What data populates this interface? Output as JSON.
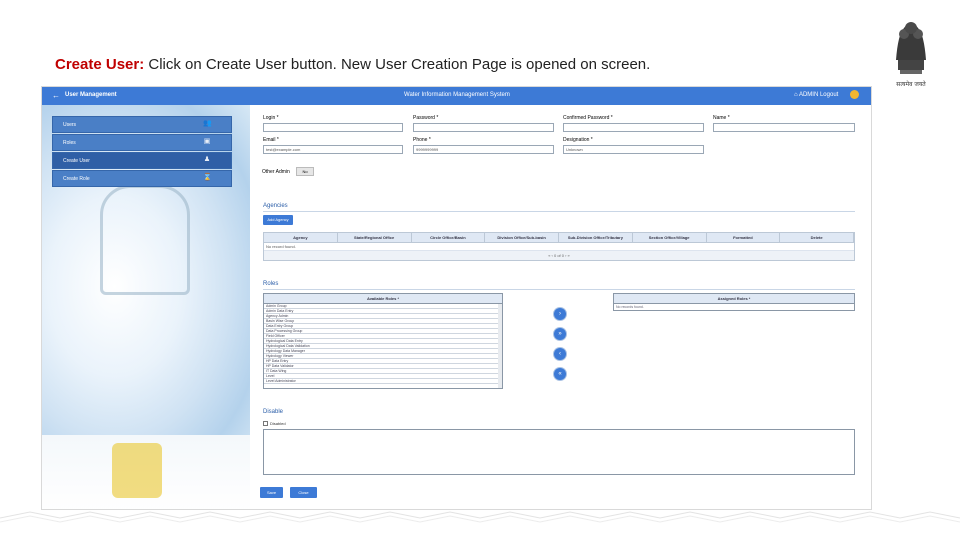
{
  "caption": {
    "lead": "Create User:",
    "text": " Click on Create User button.  New User Creation Page is opened on screen."
  },
  "emblem": {
    "text": "सत्यमेव जयते",
    "icon": "national-emblem"
  },
  "app": {
    "topbar": {
      "back_icon": "←",
      "module_title": "User Management",
      "system_title": "Water Information Management System",
      "home_icon": "⌂",
      "user_text": "ADMIN Logout"
    },
    "sidebar": {
      "items": [
        {
          "label": "Users",
          "icon": "users-icon",
          "glyph": "👥",
          "active": false
        },
        {
          "label": "Roles",
          "icon": "roles-icon",
          "glyph": "▣",
          "active": false
        },
        {
          "label": "Create User",
          "icon": "create-user-icon",
          "glyph": "♟",
          "active": true
        },
        {
          "label": "Create Role",
          "icon": "create-role-icon",
          "glyph": "⌛",
          "active": false
        }
      ]
    },
    "form": {
      "login_label": "Login *",
      "password_label": "Password *",
      "confirm_password_label": "Confirmed Password *",
      "name_label": "Name *",
      "email_label": "Email *",
      "email_value": "test@example.com",
      "phone_label": "Phone *",
      "phone_value": "9999999999",
      "designation_label": "Designation *",
      "designation_value": "Unknown",
      "other_admin_label": "Other Admin",
      "other_admin_value": "No"
    },
    "agencies": {
      "title": "Agencies",
      "add_button": "Add Agency",
      "columns": [
        "Agency",
        "State/Regional Office",
        "Circle Office/Basin",
        "Division Office/Sub-basin",
        "Sub-Division Office/Tributary",
        "Section Office/Village",
        "Formatted",
        "Delete"
      ],
      "empty_text": "No record found.",
      "pager_text": "«   ‹   0 of 0   ›   »"
    },
    "roles": {
      "title": "Roles",
      "available_header": "Available Roles *",
      "available": [
        "Admin Group",
        "Admin Data Entry",
        "Agency Admin",
        "Basin Wise Group",
        "Data Entry Group",
        "Data Processing Group",
        "Field Officer",
        "Hydrological Data Entry",
        "Hydrological Data Validation",
        "Hydrology Data Manager",
        "Hydrology Viewer",
        "HP Data Entry",
        "HP Data Validator",
        "IT Data Wing",
        "Level",
        "Level Administrator"
      ],
      "assigned_header": "Assigned Roles *",
      "assigned_empty": "No records found.",
      "move_buttons": [
        "›",
        "»",
        "‹",
        "«"
      ]
    },
    "disable": {
      "title": "Disable",
      "checkbox_label": "Disabled"
    },
    "actions": {
      "save": "Save",
      "close": "Close"
    }
  }
}
